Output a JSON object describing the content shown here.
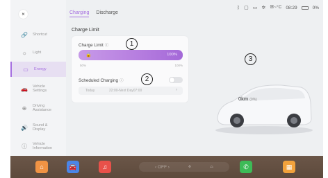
{
  "status": {
    "icons": [
      "bluetooth-icon",
      "square-icon",
      "screen-icon",
      "fan-icon",
      "temperature-icon"
    ],
    "climate": "ꕥ~°C",
    "time": "08:29",
    "battery": "0%"
  },
  "sidebar": {
    "close_glyph": "×",
    "items": [
      {
        "label": "Shortcut",
        "icon": "link-icon",
        "glyph": "🔗"
      },
      {
        "label": "Light",
        "icon": "sun-icon",
        "glyph": "☼"
      },
      {
        "label": "Energy",
        "icon": "battery-icon",
        "glyph": "▭"
      },
      {
        "label": "Vehicle\nSettings",
        "icon": "car-icon",
        "glyph": "🚗"
      },
      {
        "label": "Driving\nAssistance",
        "icon": "steering-wheel-icon",
        "glyph": "⊕"
      },
      {
        "label": "Sound &\nDisplay",
        "icon": "speaker-icon",
        "glyph": "🔊"
      },
      {
        "label": "Vehicle\nInformation",
        "icon": "info-icon",
        "glyph": "ⓘ"
      }
    ]
  },
  "tabs": [
    {
      "label": "Charging",
      "active": true
    },
    {
      "label": "Discharge",
      "active": false
    }
  ],
  "charge_limit": {
    "section_title": "Charge Limit",
    "label": "Charge Limit",
    "value_text": "100%",
    "value": 1.0,
    "scale_min": "50%",
    "scale_max": "100%",
    "lock_glyph": "🔒"
  },
  "scheduled": {
    "label": "Scheduled Charging",
    "enabled": false,
    "day": "Today",
    "time": "22:00-Next Day07:00",
    "chevron": "›"
  },
  "vehicle": {
    "km": "0km",
    "pct": "(0%)"
  },
  "callouts": [
    "1",
    "2",
    "3"
  ],
  "dock": {
    "apps": [
      {
        "name": "home-app",
        "glyph": "⌂",
        "color": "#f19344"
      },
      {
        "name": "car-app",
        "glyph": "🚘",
        "color": "#4a86e8"
      },
      {
        "name": "music-app",
        "glyph": "♫",
        "color": "#e8514a"
      },
      {
        "name": "phone-app",
        "glyph": "✆",
        "color": "#3dbb57"
      },
      {
        "name": "grid-app",
        "glyph": "▦",
        "color": "#f2a23c"
      }
    ],
    "climate": {
      "left": "‹ OFF ›",
      "fan": "⚘",
      "seat": "⌓"
    }
  },
  "colors": {
    "accent": "#a56ee0",
    "dock_bg": "#5d4a3c"
  }
}
